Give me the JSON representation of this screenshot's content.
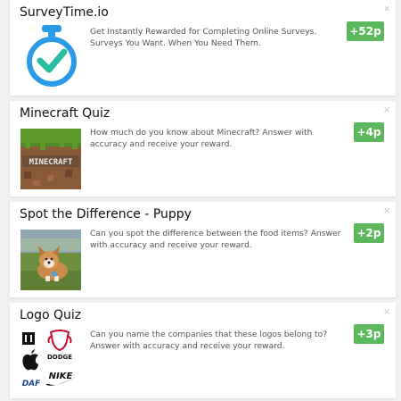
{
  "offers": [
    {
      "title": "SurveyTime.io",
      "description": "Get Instantly Rewarded for Completing Online Surveys. Surveys You Want. When You Need Them.",
      "reward": "+52p",
      "close": "×",
      "icon": "stopwatch-check-icon",
      "accent": "#2b9be7"
    },
    {
      "title": "Minecraft Quiz",
      "description": "How much do you know about Minecraft? Answer with accuracy and receive your reward.",
      "reward": "+4p",
      "close": "×",
      "icon": "minecraft-grass-block-logo",
      "logo_text": "MINECRAFT"
    },
    {
      "title": "Spot the Difference - Puppy",
      "description": "Can you spot the difference between the food items? Answer with accuracy and receive your reward.",
      "reward": "+2p",
      "close": "×",
      "icon": "puppy-photo"
    },
    {
      "title": "Logo Quiz",
      "description": "Can you name the companies that these logos belong to? Answer with accuracy and receive your reward.",
      "reward": "+3p",
      "close": "×",
      "icon": "brand-logos-collage",
      "logos": {
        "dodge": "DODGE",
        "daf": "DAF",
        "nike": "NIKE"
      }
    }
  ],
  "colors": {
    "reward_bg": "#5cb85c",
    "page_bg": "#f0f0f0"
  }
}
